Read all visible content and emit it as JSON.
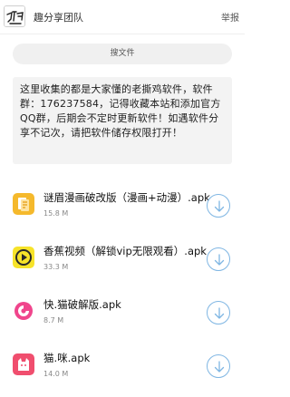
{
  "header": {
    "logo_text": "趣得客",
    "team_name": "趣分享团队",
    "report_label": "举报"
  },
  "search": {
    "label": "搜文件"
  },
  "notice": {
    "text": "这里收集的都是大家懂的老撕鸡软件，软件群：176237584，记得收藏本站和添加官方QQ群，后期会不定时更新软件！如遇软件分享不记次，请把软件储存权限打开！"
  },
  "files": [
    {
      "name": "谜眉漫画破改版（漫画+动漫）.apk",
      "size": "15.8 M",
      "icon": "manga-app-icon"
    },
    {
      "name": "香蕉视频（解锁vip无限观看）.apk",
      "size": "33.3 M",
      "icon": "banana-video-app-icon"
    },
    {
      "name": "快.猫破解版.apk",
      "size": "8.7 M",
      "icon": "kuaimao-app-icon"
    },
    {
      "name": "猫.咪.apk",
      "size": "14.0 M",
      "icon": "maomi-app-icon"
    }
  ],
  "colors": {
    "accent_blue": "#7fb6e3",
    "notice_bg": "#f3f3f3",
    "search_bg": "#f0f0f0"
  }
}
